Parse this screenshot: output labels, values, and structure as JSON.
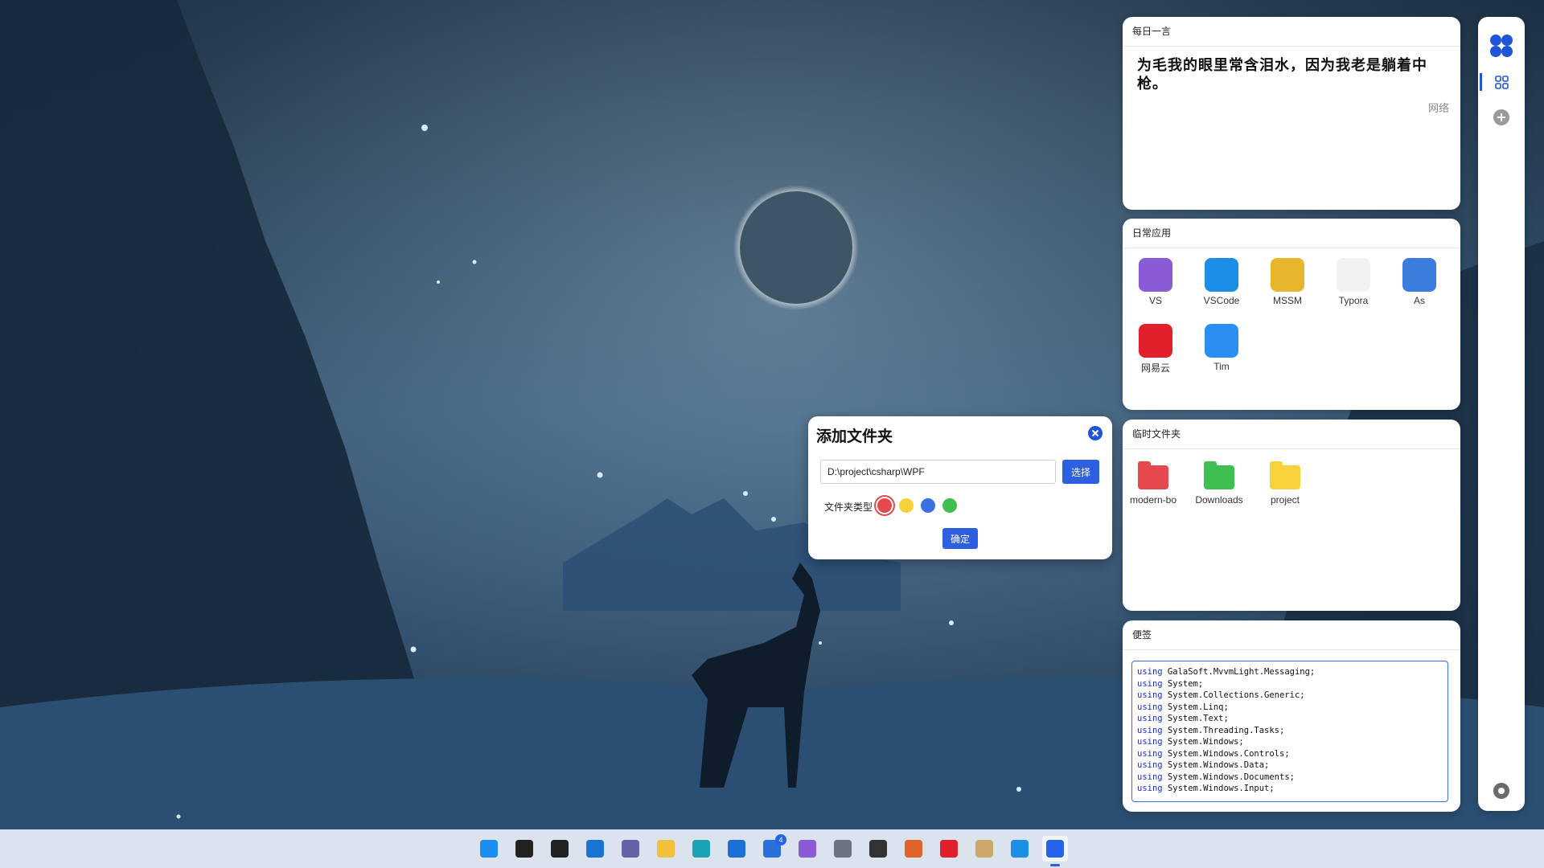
{
  "quote_widget": {
    "title": "每日一言",
    "text": "为毛我的眼里常含泪水，因为我老是躺着中枪。",
    "source": "网络"
  },
  "apps_widget": {
    "title": "日常应用",
    "apps": [
      {
        "label": "VS",
        "icon": "visual-studio-icon",
        "color": "#8a5bd6"
      },
      {
        "label": "VSCode",
        "icon": "vscode-icon",
        "color": "#1c8ee8"
      },
      {
        "label": "MSSM",
        "icon": "mssm-icon",
        "color": "#e8b62a"
      },
      {
        "label": "Typora",
        "icon": "typora-icon",
        "color": "#f2f2f2"
      },
      {
        "label": "As",
        "icon": "android-studio-icon",
        "color": "#3b7ddd"
      },
      {
        "label": "网易云",
        "icon": "netease-music-icon",
        "color": "#e2202b"
      },
      {
        "label": "Tim",
        "icon": "tim-icon",
        "color": "#2a8ff0"
      }
    ]
  },
  "temp_widget": {
    "title": "临时文件夹",
    "folders": [
      {
        "label": "modern-bo",
        "color": "#e5484d"
      },
      {
        "label": "Downloads",
        "color": "#3fbf4f"
      },
      {
        "label": "project",
        "color": "#f7d23a"
      }
    ]
  },
  "notes_widget": {
    "title": "便签",
    "lines": [
      {
        "kw": "using",
        "rest": " GalaSoft.MvvmLight.Messaging;"
      },
      {
        "kw": "using",
        "rest": " System;"
      },
      {
        "kw": "using",
        "rest": " System.Collections.Generic;"
      },
      {
        "kw": "using",
        "rest": " System.Linq;"
      },
      {
        "kw": "using",
        "rest": " System.Text;"
      },
      {
        "kw": "using",
        "rest": " System.Threading.Tasks;"
      },
      {
        "kw": "using",
        "rest": " System.Windows;"
      },
      {
        "kw": "using",
        "rest": " System.Windows.Controls;"
      },
      {
        "kw": "using",
        "rest": " System.Windows.Data;"
      },
      {
        "kw": "using",
        "rest": " System.Windows.Documents;"
      },
      {
        "kw": "using",
        "rest": " System.Windows.Input;"
      }
    ]
  },
  "dialog": {
    "title": "添加文件夹",
    "path_value": "D:\\project\\csharp\\WPF",
    "browse_label": "选择",
    "type_label": "文件夹类型",
    "colors": [
      "#e5484d",
      "#f5d23a",
      "#3b6fe6",
      "#3fbf4f"
    ],
    "selected_color": 0,
    "confirm_label": "确定"
  },
  "taskbar": {
    "todo_badge": "4",
    "items": [
      {
        "name": "start-icon",
        "color": "#1d8ef0"
      },
      {
        "name": "search-icon",
        "color": "#222222"
      },
      {
        "name": "task-view-icon",
        "color": "#222222"
      },
      {
        "name": "widgets-icon",
        "color": "#1c73d6"
      },
      {
        "name": "teams-chat-icon",
        "color": "#6264a7"
      },
      {
        "name": "file-explorer-icon",
        "color": "#f3c03b"
      },
      {
        "name": "edge-icon",
        "color": "#1ca3b8"
      },
      {
        "name": "store-icon",
        "color": "#1c6fd6"
      },
      {
        "name": "todo-icon",
        "color": "#2a6fdb"
      },
      {
        "name": "visual-studio-icon",
        "color": "#8a5bd6"
      },
      {
        "name": "settings-icon",
        "color": "#6b7280"
      },
      {
        "name": "typora-icon",
        "color": "#333333"
      },
      {
        "name": "hbuilder-icon",
        "color": "#e0622a"
      },
      {
        "name": "netease-music-icon",
        "color": "#e2202b"
      },
      {
        "name": "photo-app-icon",
        "color": "#c9a86a"
      },
      {
        "name": "vscode-icon",
        "color": "#1c8ee8"
      },
      {
        "name": "active-app-icon",
        "color": "#2563eb"
      }
    ]
  }
}
